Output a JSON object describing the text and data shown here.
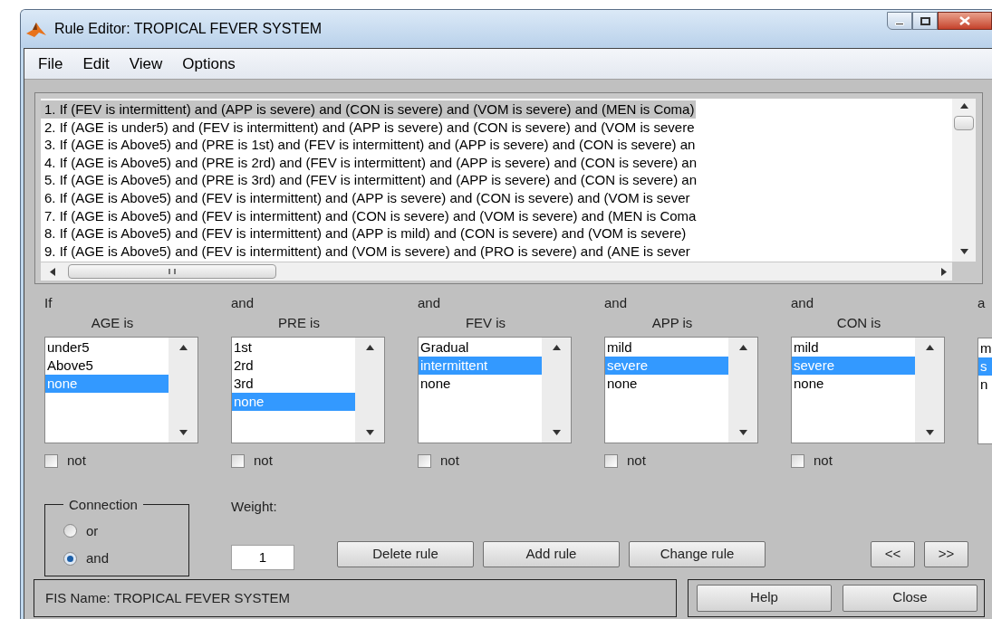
{
  "window": {
    "title": "Rule Editor: TROPICAL FEVER SYSTEM"
  },
  "menu": [
    "File",
    "Edit",
    "View",
    "Options"
  ],
  "rules": [
    {
      "text": "1. If (FEV is intermittent) and (APP is severe) and (CON is severe) and (VOM is severe) and (MEN is Coma)",
      "selected": true
    },
    {
      "text": "2. If (AGE is under5) and (FEV is intermittent) and (APP is severe) and (CON is severe) and (VOM is severe",
      "selected": false
    },
    {
      "text": "3. If (AGE is Above5) and (PRE is 1st) and (FEV is intermittent) and (APP is severe) and (CON is severe) an",
      "selected": false
    },
    {
      "text": "4. If (AGE is Above5) and (PRE is 2rd) and (FEV is intermittent) and (APP is severe) and (CON is severe) an",
      "selected": false
    },
    {
      "text": "5. If (AGE is Above5) and (PRE is 3rd) and (FEV is intermittent) and (APP is severe) and (CON is severe) an",
      "selected": false
    },
    {
      "text": "6. If (AGE is Above5) and (FEV is intermittent) and (APP is severe) and (CON is severe) and (VOM is sever",
      "selected": false
    },
    {
      "text": "7. If (AGE is Above5) and (FEV is intermittent) and (CON is severe) and (VOM is severe) and (MEN is Coma",
      "selected": false
    },
    {
      "text": "8. If (AGE is Above5) and (FEV is intermittent) and (APP is mild) and (CON is severe) and (VOM is severe)",
      "selected": false
    },
    {
      "text": "9. If (AGE is Above5) and (FEV is intermittent) and (VOM is severe) and (PRO is severe) and (ANE is sever",
      "selected": false
    }
  ],
  "columns": [
    {
      "connective": "If",
      "variable": "AGE is",
      "items": [
        {
          "label": "under5",
          "selected": false
        },
        {
          "label": "Above5",
          "selected": false
        },
        {
          "label": "none",
          "selected": true
        }
      ],
      "not": {
        "label": "not",
        "checked": false
      }
    },
    {
      "connective": "and",
      "variable": "PRE is",
      "items": [
        {
          "label": "1st",
          "selected": false
        },
        {
          "label": "2rd",
          "selected": false
        },
        {
          "label": "3rd",
          "selected": false
        },
        {
          "label": "none",
          "selected": true
        }
      ],
      "not": {
        "label": "not",
        "checked": false
      }
    },
    {
      "connective": "and",
      "variable": "FEV is",
      "items": [
        {
          "label": "Gradual",
          "selected": false
        },
        {
          "label": "intermittent",
          "selected": true
        },
        {
          "label": "none",
          "selected": false
        }
      ],
      "not": {
        "label": "not",
        "checked": false
      }
    },
    {
      "connective": "and",
      "variable": "APP is",
      "items": [
        {
          "label": "mild",
          "selected": false
        },
        {
          "label": "severe",
          "selected": true
        },
        {
          "label": "none",
          "selected": false
        }
      ],
      "not": {
        "label": "not",
        "checked": false
      }
    },
    {
      "connective": "and",
      "variable": "CON is",
      "items": [
        {
          "label": "mild",
          "selected": false
        },
        {
          "label": "severe",
          "selected": true
        },
        {
          "label": "none",
          "selected": false
        }
      ],
      "not": {
        "label": "not",
        "checked": false
      }
    },
    {
      "connective": "a",
      "items": [
        {
          "label": "m",
          "selected": false
        },
        {
          "label": "s",
          "selected": true
        },
        {
          "label": "n",
          "selected": false
        }
      ]
    }
  ],
  "connection": {
    "title": "Connection",
    "options": [
      {
        "label": "or",
        "selected": false
      },
      {
        "label": "and",
        "selected": true
      }
    ]
  },
  "weight": {
    "label": "Weight:",
    "value": "1"
  },
  "rule_buttons": [
    "Delete rule",
    "Add rule",
    "Change rule"
  ],
  "nav_buttons": [
    "<<",
    ">>"
  ],
  "status": "FIS Name: TROPICAL FEVER SYSTEM",
  "footer_buttons": [
    "Help",
    "Close"
  ]
}
